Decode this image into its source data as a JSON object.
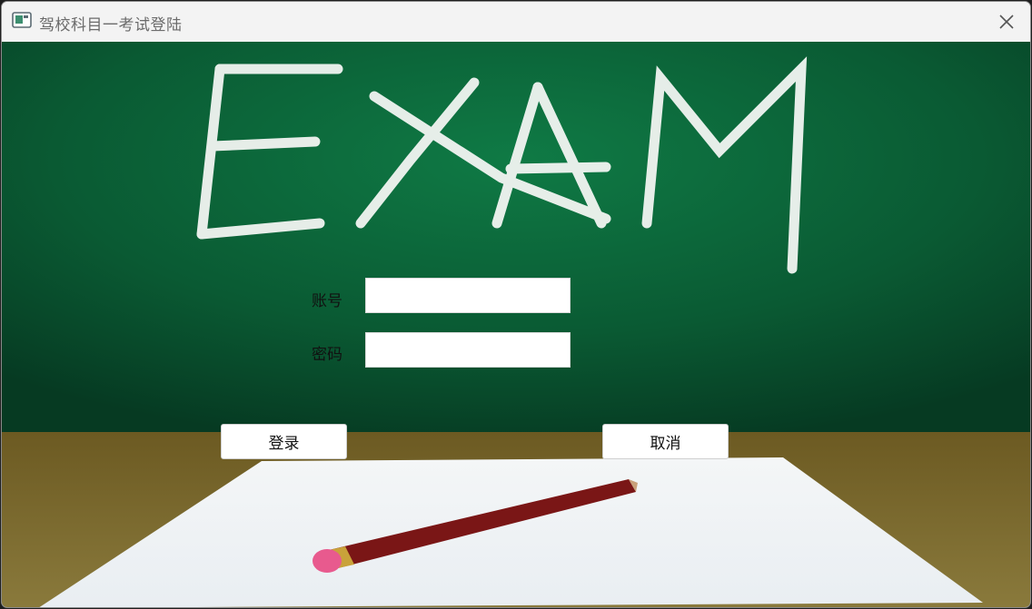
{
  "window": {
    "title": "驾校科目一考试登陆"
  },
  "background": {
    "chalk_text": "EXAM"
  },
  "form": {
    "account_label": "账号",
    "account_value": "",
    "password_label": "密码",
    "password_value": ""
  },
  "buttons": {
    "login_label": "登录",
    "cancel_label": "取消"
  },
  "colors": {
    "chalkboard": "#0e6b3c",
    "chalk": "#f2f5f2",
    "desk": "#7a6a2c",
    "paper": "#f7f8f9",
    "pencil": "#7a1616",
    "eraser": "#e85a8e"
  }
}
